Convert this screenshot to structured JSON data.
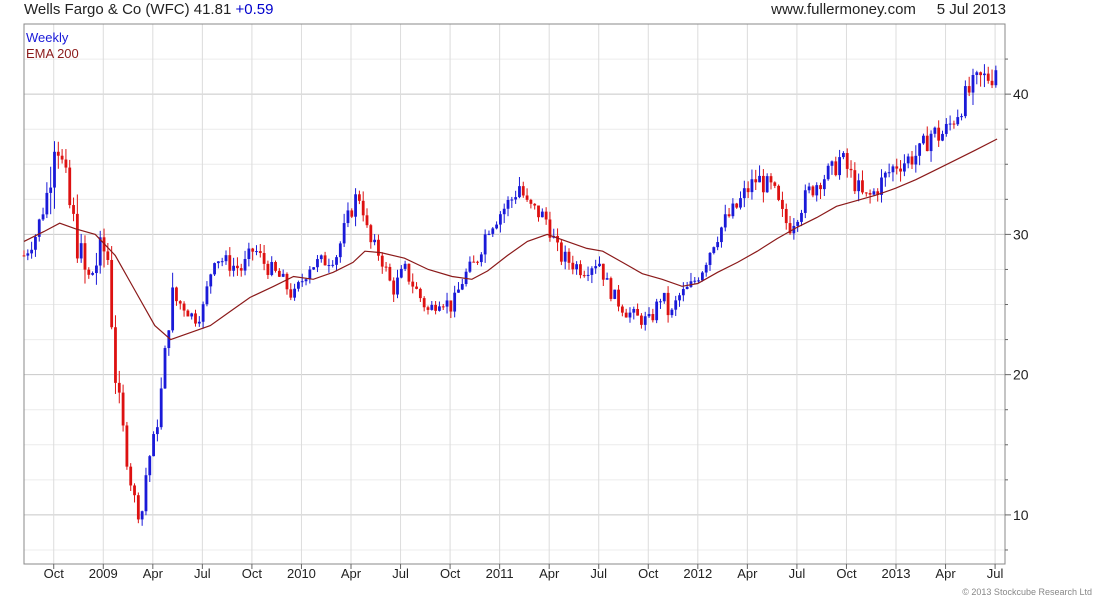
{
  "header": {
    "name": "Wells Fargo & Co (WFC)",
    "price": "41.81",
    "change": "+0.59",
    "site": "www.fullermoney.com",
    "date": "5 Jul 2013"
  },
  "footer": {
    "copyright": "© 2013 Stockcube Research Ltd"
  },
  "colors": {
    "up": "#1a1ad8",
    "down": "#dd1111",
    "ema": "#8b1a1a",
    "grid": "#d9d9d9"
  },
  "chart_data": {
    "type": "candlestick",
    "title": "Wells Fargo & Co (WFC) 41.81 +0.59",
    "legend": [
      "Weekly",
      "EMA 200"
    ],
    "legend_placement": "top-left",
    "grid": true,
    "y_axis_side": "right",
    "ylim": [
      6.5,
      45
    ],
    "y_ticks": [
      10,
      20,
      30,
      40
    ],
    "x_range": [
      2008.6,
      2013.55
    ],
    "x_ticks": [
      {
        "label": "Oct",
        "t": 2008.75
      },
      {
        "label": "2009",
        "t": 2009.0
      },
      {
        "label": "Apr",
        "t": 2009.25
      },
      {
        "label": "Jul",
        "t": 2009.5
      },
      {
        "label": "Oct",
        "t": 2009.75
      },
      {
        "label": "2010",
        "t": 2010.0
      },
      {
        "label": "Apr",
        "t": 2010.25
      },
      {
        "label": "Jul",
        "t": 2010.5
      },
      {
        "label": "Oct",
        "t": 2010.75
      },
      {
        "label": "2011",
        "t": 2011.0
      },
      {
        "label": "Apr",
        "t": 2011.25
      },
      {
        "label": "Jul",
        "t": 2011.5
      },
      {
        "label": "Oct",
        "t": 2011.75
      },
      {
        "label": "2012",
        "t": 2012.0
      },
      {
        "label": "Apr",
        "t": 2012.25
      },
      {
        "label": "Jul",
        "t": 2012.5
      },
      {
        "label": "Oct",
        "t": 2012.75
      },
      {
        "label": "2013",
        "t": 2013.0
      },
      {
        "label": "Apr",
        "t": 2013.25
      },
      {
        "label": "Jul",
        "t": 2013.5
      }
    ],
    "price_path": [
      [
        2008.6,
        28.5
      ],
      [
        2008.66,
        30.0
      ],
      [
        2008.72,
        33.0
      ],
      [
        2008.76,
        38.0
      ],
      [
        2008.8,
        34.0
      ],
      [
        2008.86,
        30.0
      ],
      [
        2008.92,
        26.5
      ],
      [
        2008.98,
        28.5
      ],
      [
        2009.02,
        29.0
      ],
      [
        2009.06,
        20.0
      ],
      [
        2009.1,
        16.0
      ],
      [
        2009.13,
        13.0
      ],
      [
        2009.16,
        11.0
      ],
      [
        2009.19,
        9.5
      ],
      [
        2009.22,
        13.5
      ],
      [
        2009.26,
        15.5
      ],
      [
        2009.3,
        19.5
      ],
      [
        2009.34,
        25.5
      ],
      [
        2009.4,
        25.0
      ],
      [
        2009.46,
        24.0
      ],
      [
        2009.5,
        24.5
      ],
      [
        2009.56,
        28.5
      ],
      [
        2009.62,
        28.0
      ],
      [
        2009.7,
        27.5
      ],
      [
        2009.76,
        29.0
      ],
      [
        2009.82,
        27.8
      ],
      [
        2009.9,
        26.8
      ],
      [
        2009.96,
        25.5
      ],
      [
        2010.04,
        27.8
      ],
      [
        2010.1,
        28.0
      ],
      [
        2010.18,
        28.6
      ],
      [
        2010.22,
        30.5
      ],
      [
        2010.27,
        32.5
      ],
      [
        2010.3,
        32.8
      ],
      [
        2010.34,
        29.5
      ],
      [
        2010.4,
        28.5
      ],
      [
        2010.46,
        26.0
      ],
      [
        2010.52,
        27.5
      ],
      [
        2010.58,
        26.0
      ],
      [
        2010.64,
        24.5
      ],
      [
        2010.7,
        25.5
      ],
      [
        2010.76,
        24.8
      ],
      [
        2010.82,
        27.0
      ],
      [
        2010.88,
        28.0
      ],
      [
        2010.94,
        30.5
      ],
      [
        2011.0,
        31.5
      ],
      [
        2011.06,
        32.5
      ],
      [
        2011.1,
        33.5
      ],
      [
        2011.14,
        32.0
      ],
      [
        2011.2,
        31.5
      ],
      [
        2011.24,
        31.0
      ],
      [
        2011.3,
        28.5
      ],
      [
        2011.36,
        28.0
      ],
      [
        2011.42,
        27.5
      ],
      [
        2011.5,
        28.2
      ],
      [
        2011.54,
        26.5
      ],
      [
        2011.58,
        25.5
      ],
      [
        2011.64,
        24.5
      ],
      [
        2011.7,
        24.0
      ],
      [
        2011.76,
        23.8
      ],
      [
        2011.82,
        25.8
      ],
      [
        2011.86,
        24.0
      ],
      [
        2011.9,
        25.5
      ],
      [
        2011.96,
        26.2
      ],
      [
        2012.02,
        27.5
      ],
      [
        2012.08,
        29.5
      ],
      [
        2012.14,
        31.0
      ],
      [
        2012.2,
        32.0
      ],
      [
        2012.24,
        33.0
      ],
      [
        2012.3,
        34.0
      ],
      [
        2012.34,
        33.5
      ],
      [
        2012.38,
        33.2
      ],
      [
        2012.42,
        31.5
      ],
      [
        2012.46,
        30.5
      ],
      [
        2012.5,
        31.5
      ],
      [
        2012.56,
        33.0
      ],
      [
        2012.62,
        34.0
      ],
      [
        2012.68,
        34.5
      ],
      [
        2012.72,
        35.5
      ],
      [
        2012.76,
        34.5
      ],
      [
        2012.8,
        33.5
      ],
      [
        2012.84,
        32.5
      ],
      [
        2012.88,
        32.8
      ],
      [
        2012.94,
        34.0
      ],
      [
        2013.0,
        35.0
      ],
      [
        2013.04,
        35.2
      ],
      [
        2013.08,
        35.5
      ],
      [
        2013.12,
        35.8
      ],
      [
        2013.18,
        37.3
      ],
      [
        2013.22,
        37.0
      ],
      [
        2013.26,
        37.5
      ],
      [
        2013.3,
        38.5
      ],
      [
        2013.36,
        40.0
      ],
      [
        2013.42,
        41.0
      ],
      [
        2013.48,
        41.3
      ],
      [
        2013.51,
        41.81
      ]
    ],
    "ema_path": [
      [
        2008.6,
        29.5
      ],
      [
        2008.7,
        30.2
      ],
      [
        2008.78,
        30.8
      ],
      [
        2008.86,
        30.4
      ],
      [
        2008.96,
        30.0
      ],
      [
        2009.06,
        28.5
      ],
      [
        2009.16,
        26.0
      ],
      [
        2009.26,
        23.5
      ],
      [
        2009.34,
        22.5
      ],
      [
        2009.44,
        23.0
      ],
      [
        2009.54,
        23.5
      ],
      [
        2009.64,
        24.5
      ],
      [
        2009.74,
        25.5
      ],
      [
        2009.86,
        26.3
      ],
      [
        2009.96,
        27.0
      ],
      [
        2010.06,
        26.8
      ],
      [
        2010.16,
        27.3
      ],
      [
        2010.26,
        28.0
      ],
      [
        2010.32,
        28.8
      ],
      [
        2010.4,
        28.7
      ],
      [
        2010.52,
        28.3
      ],
      [
        2010.64,
        27.5
      ],
      [
        2010.76,
        27.0
      ],
      [
        2010.86,
        26.8
      ],
      [
        2010.94,
        27.4
      ],
      [
        2011.04,
        28.5
      ],
      [
        2011.14,
        29.5
      ],
      [
        2011.24,
        30.0
      ],
      [
        2011.34,
        29.5
      ],
      [
        2011.44,
        29.0
      ],
      [
        2011.52,
        28.8
      ],
      [
        2011.62,
        28.0
      ],
      [
        2011.72,
        27.2
      ],
      [
        2011.82,
        26.8
      ],
      [
        2011.92,
        26.3
      ],
      [
        2012.0,
        26.5
      ],
      [
        2012.1,
        27.3
      ],
      [
        2012.2,
        28.0
      ],
      [
        2012.3,
        28.8
      ],
      [
        2012.4,
        29.7
      ],
      [
        2012.5,
        30.5
      ],
      [
        2012.6,
        31.2
      ],
      [
        2012.7,
        32.0
      ],
      [
        2012.8,
        32.4
      ],
      [
        2012.9,
        32.8
      ],
      [
        2013.0,
        33.3
      ],
      [
        2013.1,
        33.9
      ],
      [
        2013.2,
        34.6
      ],
      [
        2013.3,
        35.3
      ],
      [
        2013.4,
        36.0
      ],
      [
        2013.51,
        36.8
      ]
    ]
  }
}
